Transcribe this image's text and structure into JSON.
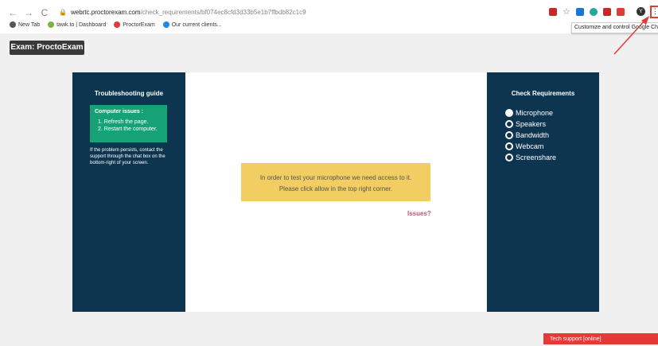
{
  "browser": {
    "url_host": "webrtc.proctorexam.com",
    "url_path": "/check_requirements/bf074ec8cfd3d33b5e1b7ffbdb82c1c9",
    "menu_label": "⋮",
    "tooltip": "Customize and control Google Chrome",
    "avatar_letter": "Y",
    "bookmarks": [
      {
        "label": "New Tab",
        "color": "#555555"
      },
      {
        "label": "tawk.to | Dashboard",
        "color": "#7cb342"
      },
      {
        "label": "ProctorExam",
        "color": "#e53935"
      },
      {
        "label": "Our current clients...",
        "color": "#1e88e5"
      }
    ]
  },
  "exam_label": "Exam: ProctoExam",
  "troubleshooting": {
    "title": "Troubleshooting guide",
    "box_title": "Computer issues :",
    "steps": [
      "1. Refresh the page.",
      "2. Restart the computer."
    ],
    "note": "If the problem persists, contact the support through the chat box on the bottom-right of your screen."
  },
  "requirements": {
    "title": "Check Requirements",
    "items": [
      {
        "label": "Microphone",
        "checked": true
      },
      {
        "label": "Speakers",
        "checked": false
      },
      {
        "label": "Bandwidth",
        "checked": false
      },
      {
        "label": "Webcam",
        "checked": false
      },
      {
        "label": "Screenshare",
        "checked": false
      }
    ]
  },
  "notice": {
    "line1": "In order to test your microphone we need access to it.",
    "line2": "Please click allow in the top right corner."
  },
  "issues_link": "Issues?",
  "tech_support": "Tech support [online]",
  "colors": {
    "panel": "#0e3550",
    "green": "#16a275",
    "notice": "#f1cd62",
    "accent_red": "#e53935"
  }
}
